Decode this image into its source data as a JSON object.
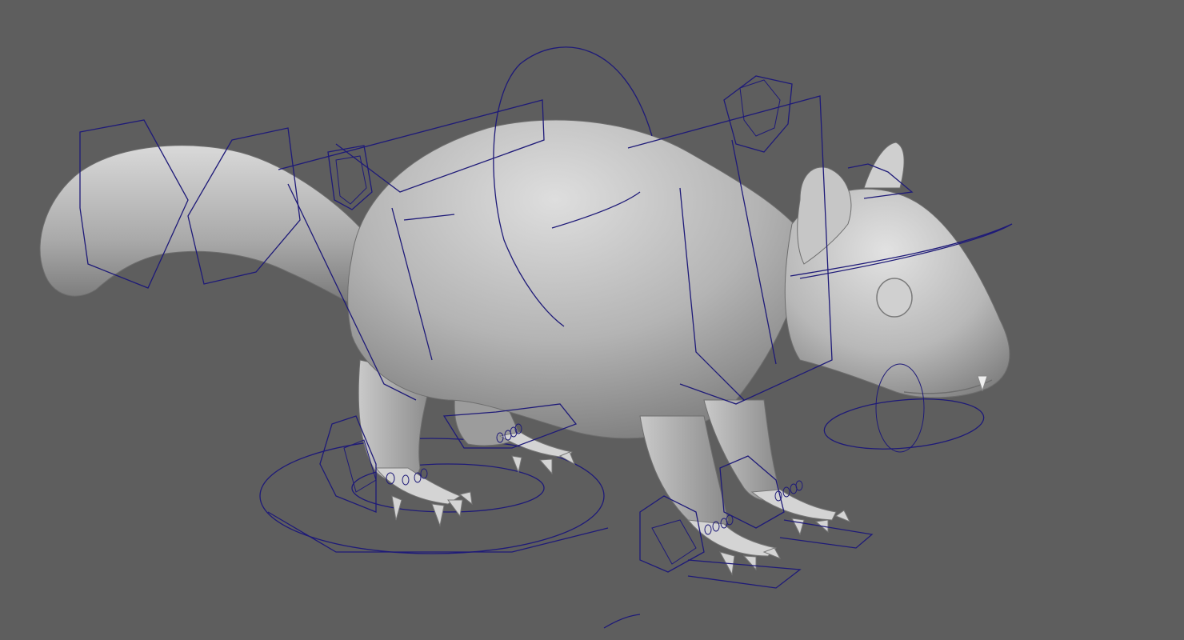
{
  "viewport": {
    "background_color": "#5e5e5e",
    "control_curve_color": "#1e1a78",
    "mesh_shade_light": "#d8d8d8",
    "mesh_shade_dark": "#7a7a7a",
    "shading_mode": "smooth-shaded",
    "subject": "squirrel-rig"
  }
}
